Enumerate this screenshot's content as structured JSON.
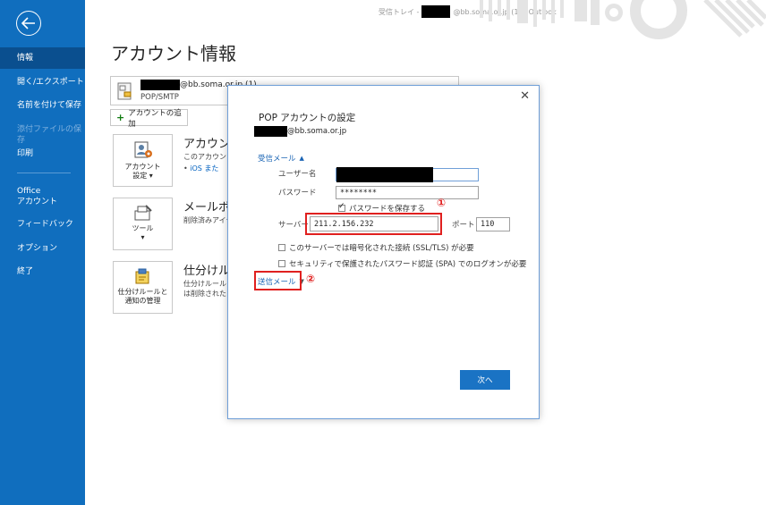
{
  "window": {
    "title_prefix": "受信トレイ - ",
    "title_suffix": "@bb.soma.or.jp (1)  -  Outlook"
  },
  "sidebar": {
    "back_icon": "back-arrow-icon",
    "items": [
      {
        "label": "情報",
        "active": true
      },
      {
        "label": "開く/エクスポート"
      },
      {
        "label": "名前を付けて保存"
      },
      {
        "label": "添付ファイルの保存",
        "disabled": true
      },
      {
        "label": "印刷"
      },
      {
        "label": "Office\nアカウント"
      },
      {
        "label": "フィードバック"
      },
      {
        "label": "オプション"
      },
      {
        "label": "終了"
      }
    ]
  },
  "main": {
    "page_title": "アカウント情報",
    "account": {
      "email_suffix": "@bb.soma.or.jp (1)",
      "type": "POP/SMTP"
    },
    "add_account_label": "アカウントの追加",
    "sections": [
      {
        "button": "アカウント\n設定 ▾",
        "title": "アカウント",
        "desc": "このアカウントの",
        "link": "iOS また"
      },
      {
        "button": "ツール\n▾",
        "title": "メールボッ",
        "desc": "削除済みアイテ"
      },
      {
        "button": "仕分けルールと\n通知の管理",
        "title": "仕分けル",
        "desc": "仕分けルールと\nは削除されたと"
      }
    ]
  },
  "dialog": {
    "title": "POP アカウントの設定",
    "email_suffix": "@bb.soma.or.jp",
    "close_icon": "close-icon",
    "incoming_label": "受信メール",
    "username_label": "ユーザー名",
    "password_label": "パスワード",
    "password_value": "********",
    "remember_password": "パスワードを保存する",
    "server_label": "サーバー",
    "server_value": "211.2.156.232",
    "port_label": "ポート",
    "port_value": "110",
    "ssl_label": "このサーバーでは暗号化された接続 (SSL/TLS) が必要",
    "spa_label": "セキュリティで保護されたパスワード認証 (SPA) でのログオンが必要",
    "outgoing_label": "送信メール",
    "next_button": "次へ",
    "marker1": "①",
    "marker2": "②",
    "highlight_color": "#e0201f"
  }
}
